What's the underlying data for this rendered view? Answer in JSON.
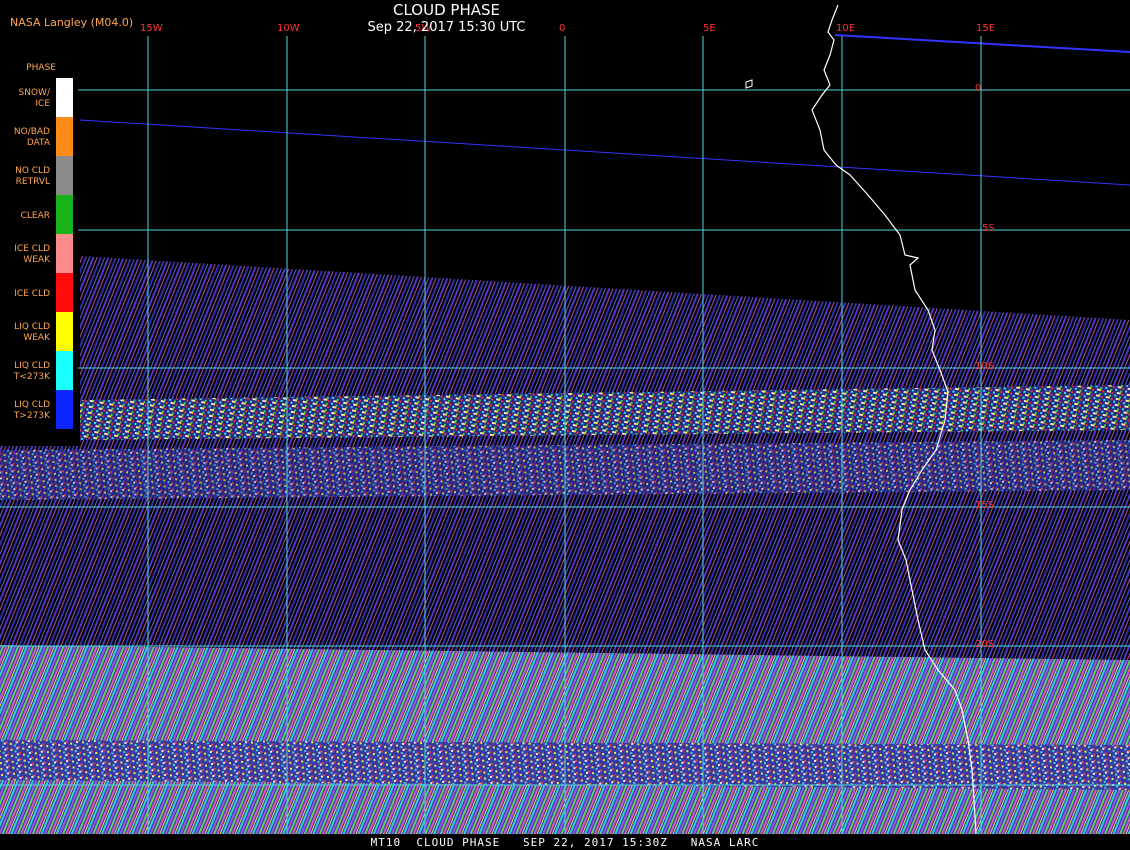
{
  "header": {
    "credit": "NASA Langley (M04.0)",
    "title": "CLOUD PHASE",
    "subtitle": "Sep 22, 2017 15:30 UTC"
  },
  "footer": {
    "text": "MT10  CLOUD PHASE   SEP 22, 2017 15:30Z   NASA LARC"
  },
  "legend": {
    "title": "PHASE",
    "items": [
      {
        "label": "SNOW/\nICE",
        "color": "#ffffff"
      },
      {
        "label": "NO/BAD\nDATA",
        "color": "#ff8a1a"
      },
      {
        "label": "NO CLD\nRETRVL",
        "color": "#8c8c8c"
      },
      {
        "label": "CLEAR",
        "color": "#19b319"
      },
      {
        "label": "ICE CLD\nWEAK",
        "color": "#ff8c8c"
      },
      {
        "label": "ICE CLD",
        "color": "#ff0d0d"
      },
      {
        "label": "LIQ CLD\nWEAK",
        "color": "#ffff00"
      },
      {
        "label": "LIQ CLD\nT<273K",
        "color": "#19ffff"
      },
      {
        "label": "LIQ CLD\nT>273K",
        "color": "#0d26ff"
      }
    ]
  },
  "grid": {
    "longitude_labels": [
      "15W",
      "10W",
      "5W",
      "0",
      "5E",
      "10E",
      "15E"
    ],
    "latitude_labels": [
      "0",
      "5S",
      "10S",
      "15S",
      "20S"
    ],
    "line_color": "#4fd4e0",
    "label_color": "#ff3030"
  },
  "map": {
    "background": "#000000",
    "coastline_color": "#ffffff",
    "swath_edge_color": "#3333ff"
  }
}
